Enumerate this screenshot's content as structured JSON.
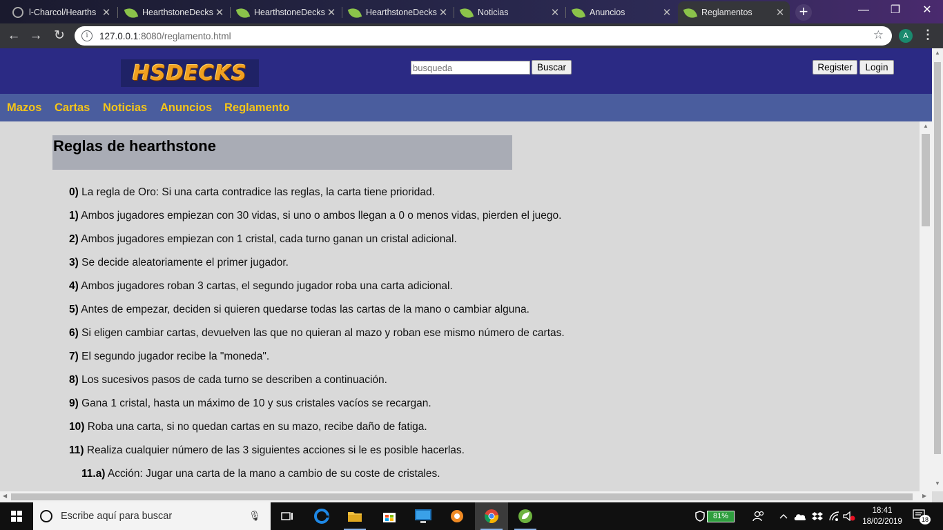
{
  "browser": {
    "tabs": [
      {
        "title": "l-Charcol/Hearths",
        "icon": "github-icon",
        "active": false
      },
      {
        "title": "HearthstoneDecks",
        "icon": "spring-leaf-icon",
        "active": false
      },
      {
        "title": "HearthstoneDecks",
        "icon": "spring-leaf-icon",
        "active": false
      },
      {
        "title": "HearthstoneDecks",
        "icon": "spring-leaf-icon",
        "active": false
      },
      {
        "title": "Noticias",
        "icon": "spring-leaf-icon",
        "active": false
      },
      {
        "title": "Anuncios",
        "icon": "spring-leaf-icon",
        "active": false
      },
      {
        "title": "Reglamentos",
        "icon": "spring-leaf-icon",
        "active": true
      }
    ],
    "new_tab": "+",
    "url_host": "127.0.0.1",
    "url_path": ":8080/reglamento.html",
    "profile_initial": "A",
    "window_controls": {
      "minimize": "—",
      "restore": "❐",
      "close": "✕"
    }
  },
  "site": {
    "logo_text": "HSDECKS",
    "search": {
      "placeholder": "busqueda",
      "button": "Buscar"
    },
    "auth": {
      "register": "Register",
      "login": "Login"
    },
    "nav": [
      "Mazos",
      "Cartas",
      "Noticias",
      "Anuncios",
      "Reglamento"
    ],
    "colors": {
      "header": "#2b2a84",
      "nav": "#4a5d9e",
      "nav_link": "#f5c518",
      "page_bg": "#d9d9d9",
      "title_box": "#a9acb5"
    }
  },
  "rules": {
    "title": "Reglas de hearthstone",
    "items": [
      {
        "num": "0)",
        "text": " La regla de Oro: Si una carta contradice las reglas, la carta tiene prioridad."
      },
      {
        "num": "1)",
        "text": " Ambos jugadores empiezan con 30 vidas, si uno o ambos llegan a 0 o menos vidas, pierden el juego."
      },
      {
        "num": "2)",
        "text": " Ambos jugadores empiezan con 1 cristal, cada turno ganan un cristal adicional."
      },
      {
        "num": "3)",
        "text": " Se decide aleatoriamente el primer jugador."
      },
      {
        "num": "4)",
        "text": " Ambos jugadores roban 3 cartas, el segundo jugador roba una carta adicional."
      },
      {
        "num": "5)",
        "text": " Antes de empezar, deciden si quieren quedarse todas las cartas de la mano o cambiar alguna."
      },
      {
        "num": "6)",
        "text": " Si eligen cambiar cartas, devuelven las que no quieran al mazo y roban ese mismo número de cartas."
      },
      {
        "num": "7)",
        "text": " El segundo jugador recibe la \"moneda\"."
      },
      {
        "num": "8)",
        "text": " Los sucesivos pasos de cada turno se describen a continuación."
      },
      {
        "num": "9)",
        "text": " Gana 1 cristal, hasta un máximo de 10 y sus cristales vacíos se recargan."
      },
      {
        "num": "10)",
        "text": " Roba una carta, si no quedan cartas en su mazo, recibe daño de fatiga."
      },
      {
        "num": "11)",
        "text": " Realiza cualquier número de las 3 siguientes acciones si le es posible hacerlas."
      },
      {
        "num": "11.a)",
        "text": " Acción: Jugar una carta de la mano a cambio de su coste de cristales."
      }
    ]
  },
  "taskbar": {
    "search_placeholder": "Escribe aquí para buscar",
    "apps": [
      "task-view-icon",
      "edge-icon",
      "file-explorer-icon",
      "store-icon",
      "lenovo-icon",
      "settings-gear-icon",
      "chrome-icon",
      "spring-tool-suite-icon"
    ],
    "battery": "81%",
    "time": "18:41",
    "date": "18/02/2019",
    "notifications": "18"
  }
}
